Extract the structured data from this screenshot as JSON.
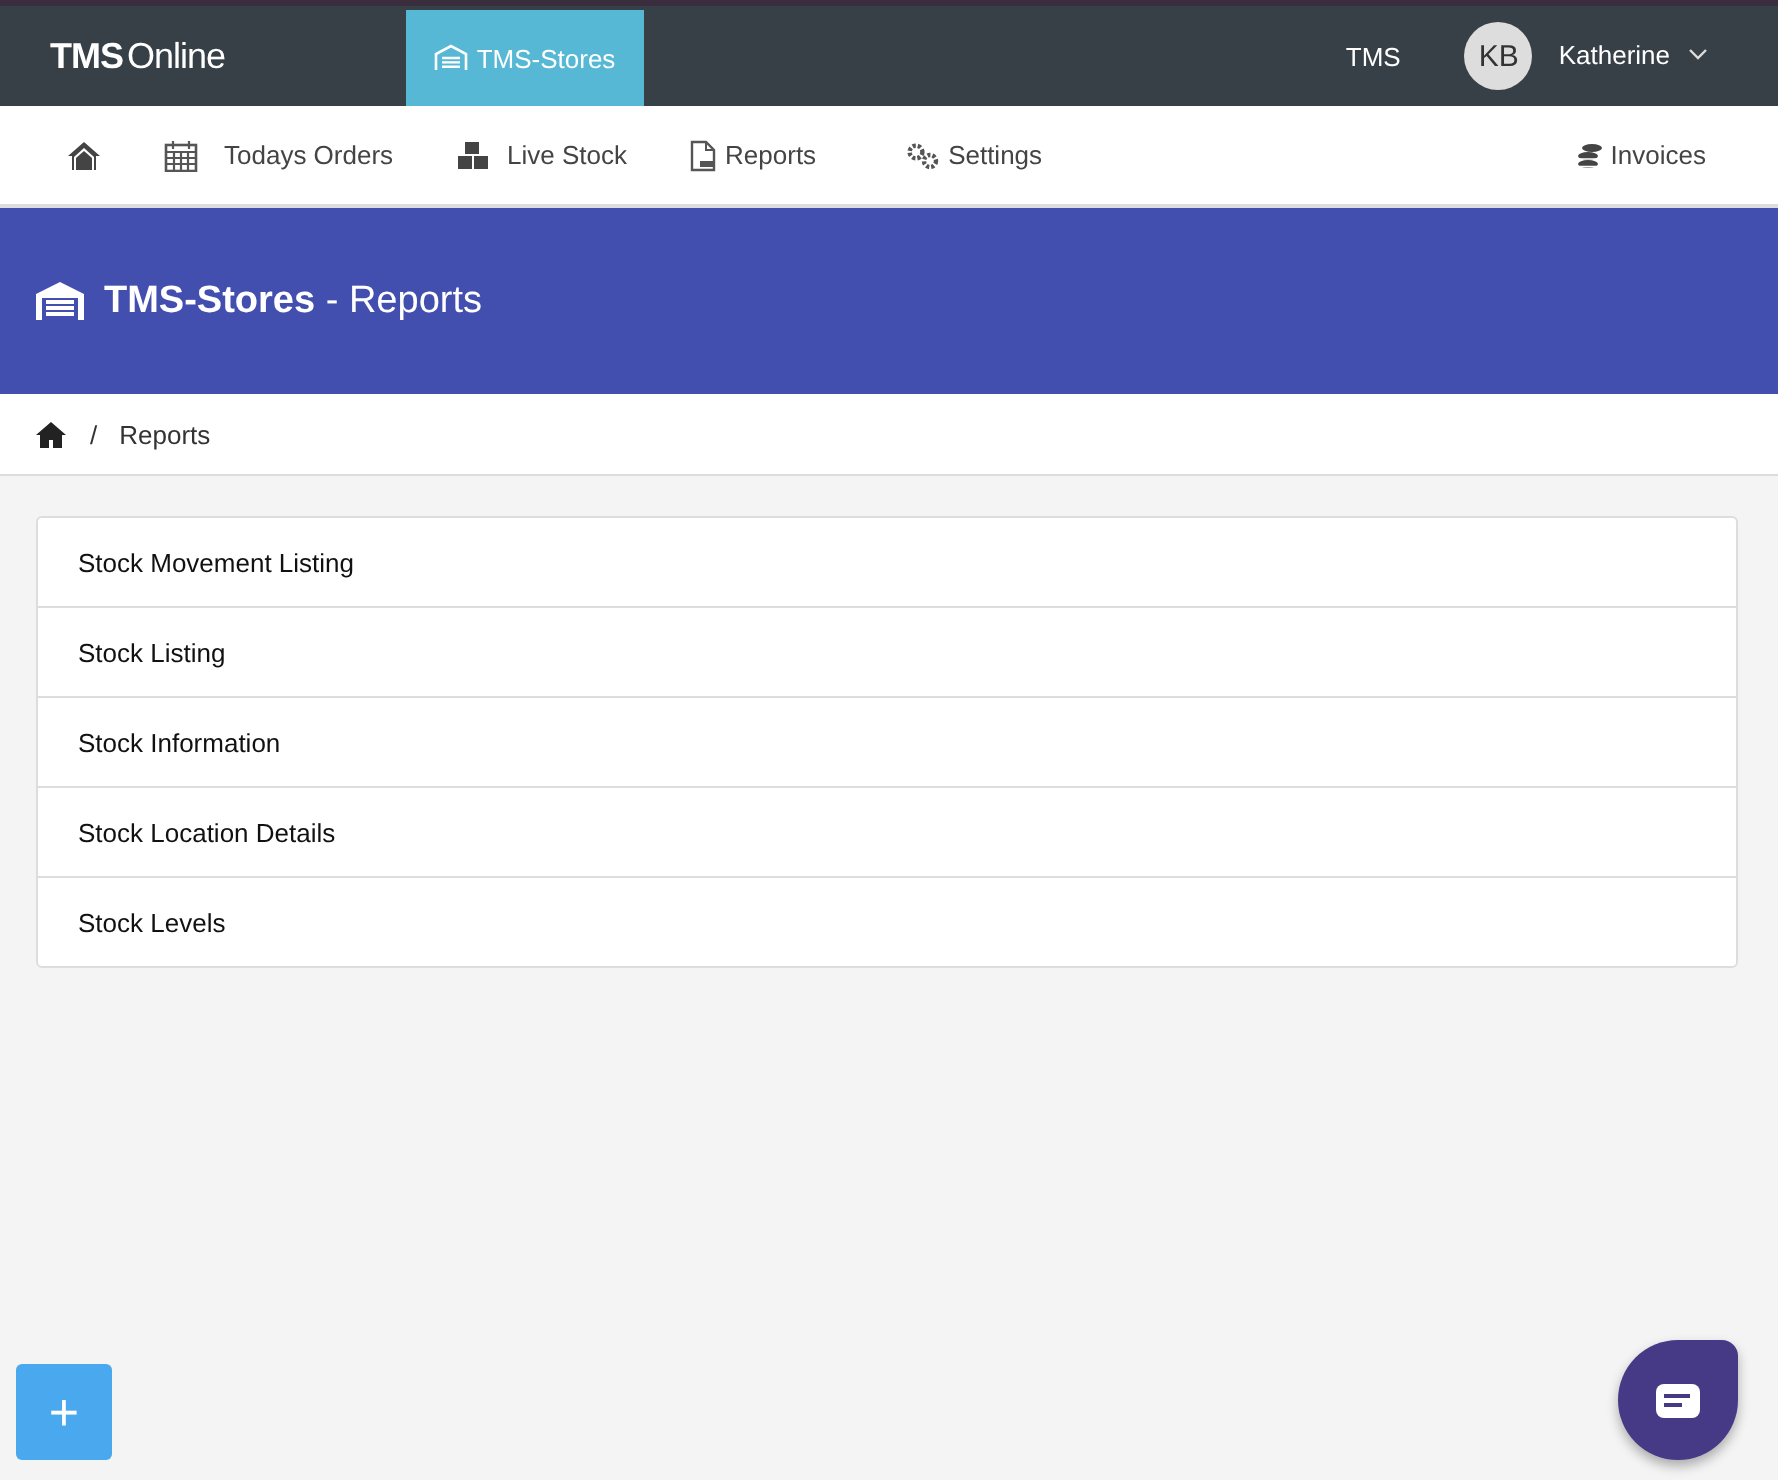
{
  "topbar": {
    "logo_bold": "TMS",
    "logo_light": "Online",
    "app_tab": {
      "label": "TMS-Stores",
      "selected": true
    },
    "company": "TMS",
    "user": {
      "initials": "KB",
      "name": "Katherine"
    }
  },
  "nav": {
    "items": [
      {
        "label": "Todays Orders"
      },
      {
        "label": "Live Stock"
      },
      {
        "label": "Reports"
      },
      {
        "label": "Settings"
      }
    ],
    "right": {
      "label": "Invoices"
    }
  },
  "banner": {
    "title_bold": "TMS-Stores",
    "title_rest": " - Reports"
  },
  "breadcrumb": {
    "separator": "/",
    "current": "Reports"
  },
  "reports": [
    "Stock Movement Listing",
    "Stock Listing",
    "Stock Information",
    "Stock Location Details",
    "Stock Levels"
  ],
  "fab": {
    "label": "+"
  }
}
